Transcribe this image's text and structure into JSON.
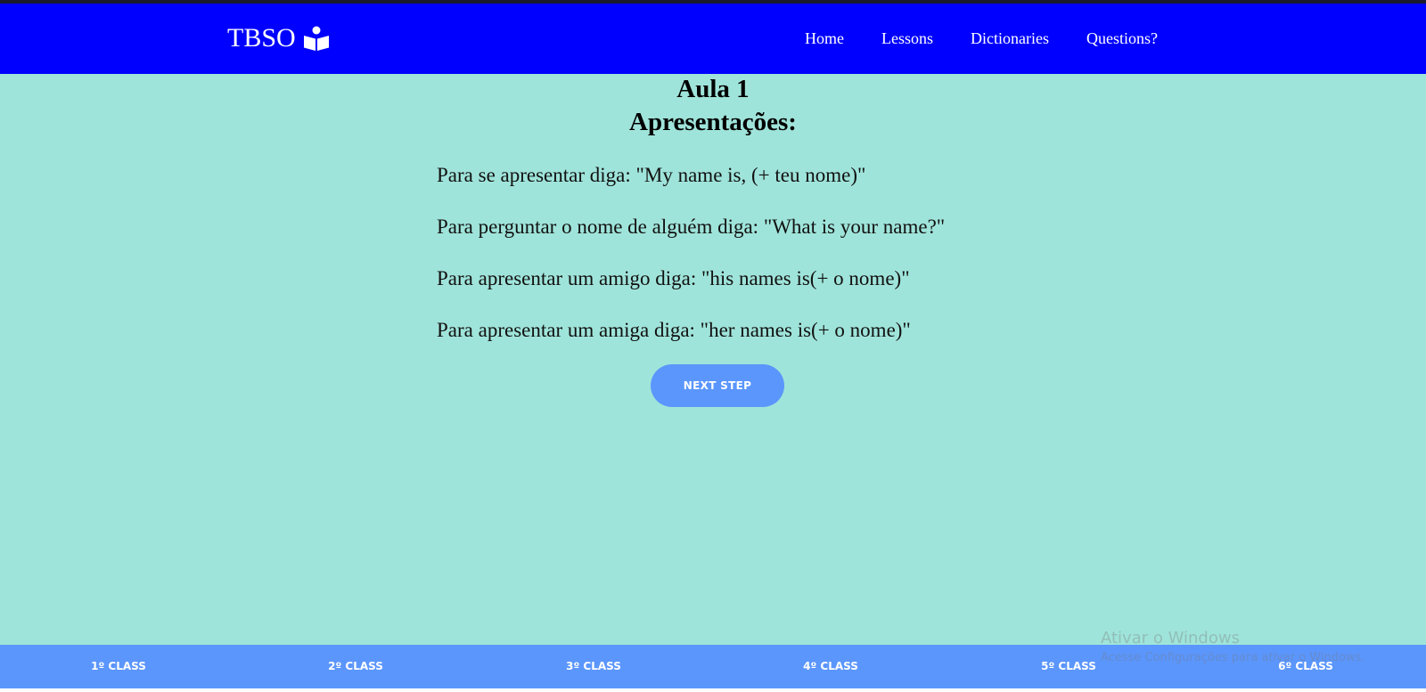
{
  "header": {
    "brand": "TBSO",
    "brand_icon": "reader-book-icon",
    "nav": [
      "Home",
      "Lessons",
      "Dictionaries",
      "Questions?"
    ]
  },
  "lesson": {
    "title_line1": "Aula 1",
    "title_line2": "Apresentações:",
    "paragraphs": [
      "Para se apresentar diga: \"My name is, (+ teu nome)\"",
      "Para perguntar o nome de alguém diga: \"What is your name?\"",
      "Para apresentar um amigo diga: \"his names is(+ o nome)\"",
      "Para apresentar um amiga diga: \"her names is(+ o nome)\""
    ],
    "next_button": "NEXT STEP"
  },
  "footer": {
    "classes": [
      "1º CLASS",
      "2º CLASS",
      "3º CLASS",
      "4º CLASS",
      "5º CLASS",
      "6º CLASS"
    ]
  },
  "watermark": {
    "title": "Ativar o Windows",
    "subtitle": "Acesse Configurações para ativar o Windows."
  },
  "colors": {
    "navbar": "#0000ff",
    "background": "#9fe4da",
    "button": "#5b96fc",
    "footer": "#5b96fc"
  }
}
